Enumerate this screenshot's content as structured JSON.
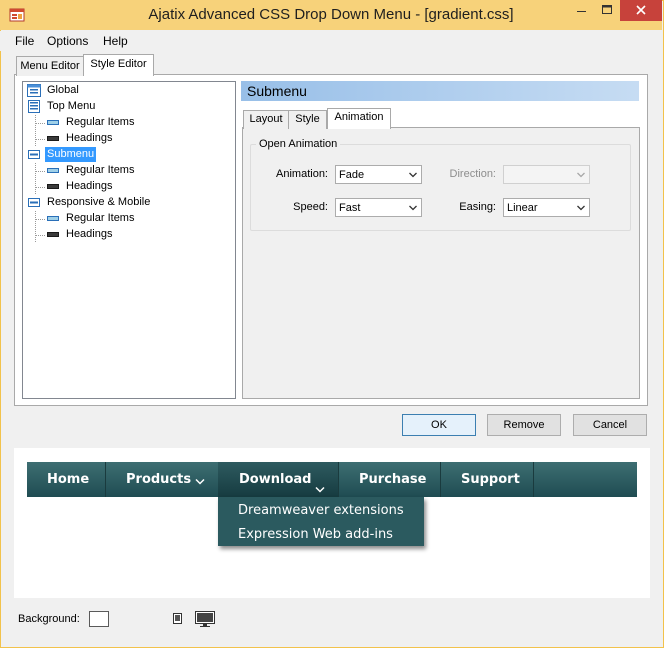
{
  "window": {
    "title": "Ajatix Advanced CSS Drop Down Menu - [gradient.css]",
    "icons": {
      "app": "menu-app-icon",
      "minimize": "minimize-icon",
      "maximize": "maximize-icon",
      "close": "close-icon"
    }
  },
  "menubar": {
    "items": [
      "File",
      "Options",
      "Help"
    ]
  },
  "editor_tabs": [
    {
      "label": "Menu Editor",
      "active": false
    },
    {
      "label": "Style Editor",
      "active": true
    }
  ],
  "tree": {
    "nodes": [
      {
        "label": "Global",
        "icon": "global-icon",
        "selected": false
      },
      {
        "label": "Top Menu",
        "icon": "menu-icon",
        "selected": false
      },
      {
        "label": "Regular Items",
        "icon": "item-icon",
        "selected": false
      },
      {
        "label": "Headings",
        "icon": "heading-icon",
        "selected": false
      },
      {
        "label": "Submenu",
        "icon": "submenu-icon",
        "selected": true
      },
      {
        "label": "Regular Items",
        "icon": "item-icon",
        "selected": false
      },
      {
        "label": "Headings",
        "icon": "heading-icon",
        "selected": false
      },
      {
        "label": "Responsive & Mobile",
        "icon": "responsive-icon",
        "selected": false
      },
      {
        "label": "Regular Items",
        "icon": "item-icon",
        "selected": false
      },
      {
        "label": "Headings",
        "icon": "heading-icon",
        "selected": false
      }
    ]
  },
  "section": {
    "title": "Submenu"
  },
  "style_tabs": [
    {
      "label": "Layout",
      "active": false
    },
    {
      "label": "Style",
      "active": false
    },
    {
      "label": "Animation",
      "active": true
    }
  ],
  "animation": {
    "group_title": "Open Animation",
    "animation_label": "Animation:",
    "animation_value": "Fade",
    "direction_label": "Direction:",
    "direction_value": "",
    "speed_label": "Speed:",
    "speed_value": "Fast",
    "easing_label": "Easing:",
    "easing_value": "Linear"
  },
  "buttons": {
    "ok": "OK",
    "remove": "Remove",
    "cancel": "Cancel"
  },
  "preview": {
    "nav_items": [
      "Home",
      "Products",
      "Download",
      "Purchase",
      "Support"
    ],
    "dropdown_items": [
      "Dreamweaver extensions",
      "Expression Web add-ins"
    ],
    "colors": {
      "nav_bg": "#2e5d62",
      "dropdown_bg": "#2b5a5f",
      "text": "#ffffff"
    }
  },
  "footer": {
    "background_label": "Background:",
    "icons": {
      "swatch": "background-color-swatch",
      "mobile": "mobile-device-icon",
      "desktop": "desktop-monitor-icon"
    }
  }
}
